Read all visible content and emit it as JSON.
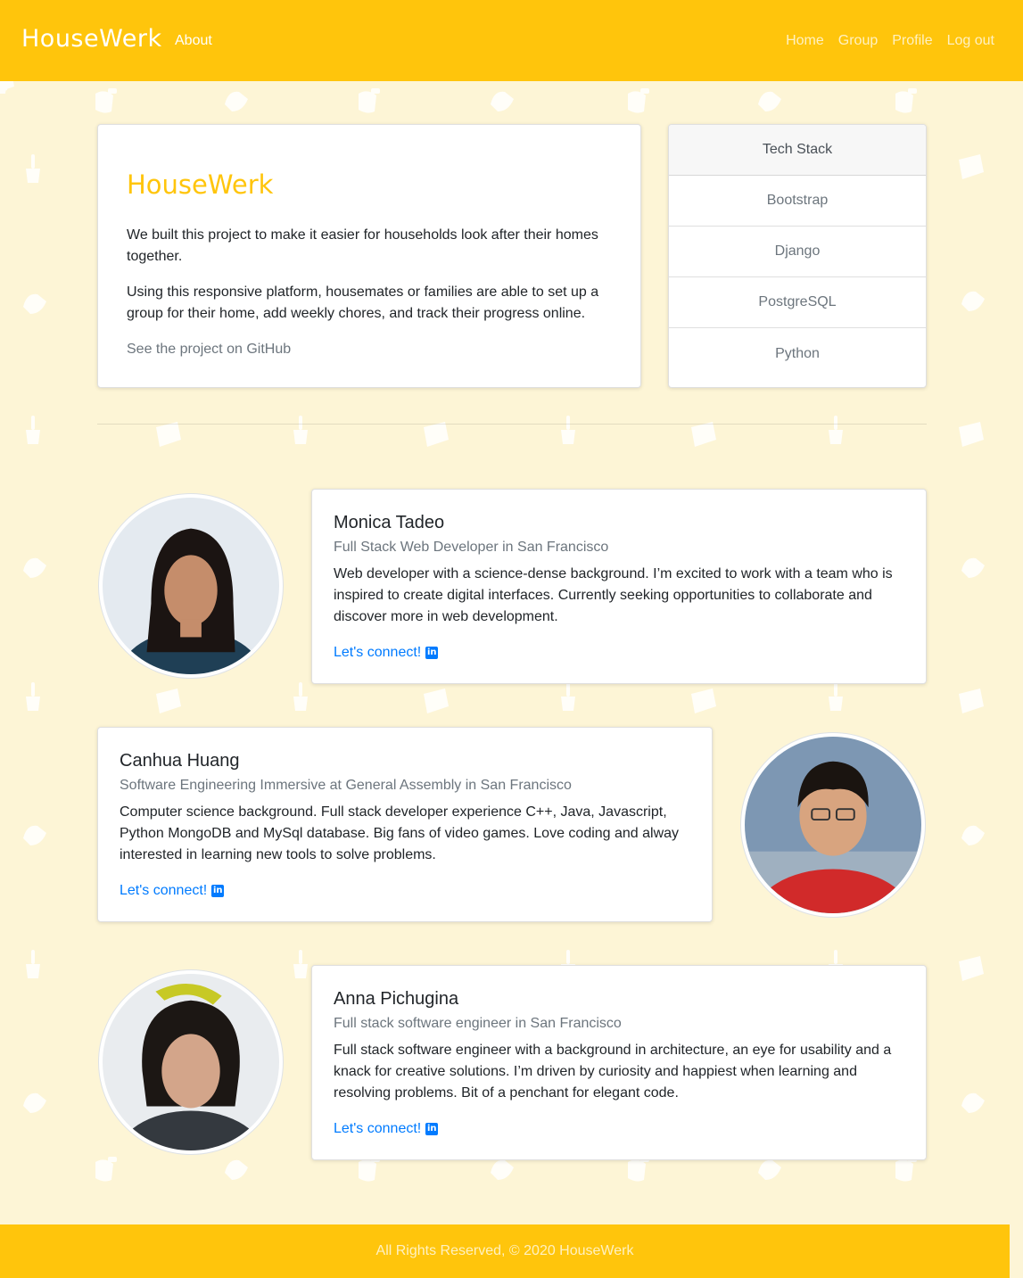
{
  "navbar": {
    "brand": "HouseWerk",
    "about": "About",
    "links": [
      "Home",
      "Group",
      "Profile",
      "Log out"
    ]
  },
  "intro": {
    "logo": "HouseWerk",
    "paragraph1": "We built this project to make it easier for households look after their homes together.",
    "paragraph2": "Using this responsive platform, housemates or families are able to set up a group for their home, add weekly chores, and track their progress online.",
    "github_link": "See the project on GitHub"
  },
  "tech_stack": {
    "header": "Tech Stack",
    "items": [
      "Bootstrap",
      "Django",
      "PostgreSQL",
      "Python"
    ]
  },
  "members": [
    {
      "name": "Monica Tadeo",
      "title": "Full Stack Web Developer in San Francisco",
      "bio": "Web developer with a science-dense background. I’m excited to work with a team who is inspired to create digital interfaces. Currently seeking opportunities to collaborate and discover more in web development.",
      "connect": "Let's connect!"
    },
    {
      "name": "Canhua Huang",
      "title": "Software Engineering Immersive at General Assembly in San Francisco",
      "bio": "Computer science background. Full stack developer experience C++, Java, Javascript, Python MongoDB and MySql database. Big fans of video games. Love coding and alway interested in learning new tools to solve problems.",
      "connect": "Let's connect!"
    },
    {
      "name": "Anna Pichugina",
      "title": "Full stack software engineer in San Francisco",
      "bio": "Full stack software engineer with a background in architecture, an eye for usability and a knack for creative solutions. I’m driven by curiosity and happiest when learning and resolving problems. Bit of a penchant for elegant code.",
      "connect": "Let's connect!"
    }
  ],
  "icons": {
    "linkedin": "linkedin-icon"
  },
  "colors": {
    "brand": "#ffc50c",
    "background": "#fdf5d6",
    "link": "#007bff"
  },
  "footer": {
    "text": "All Rights Reserved, © 2020 HouseWerk"
  }
}
